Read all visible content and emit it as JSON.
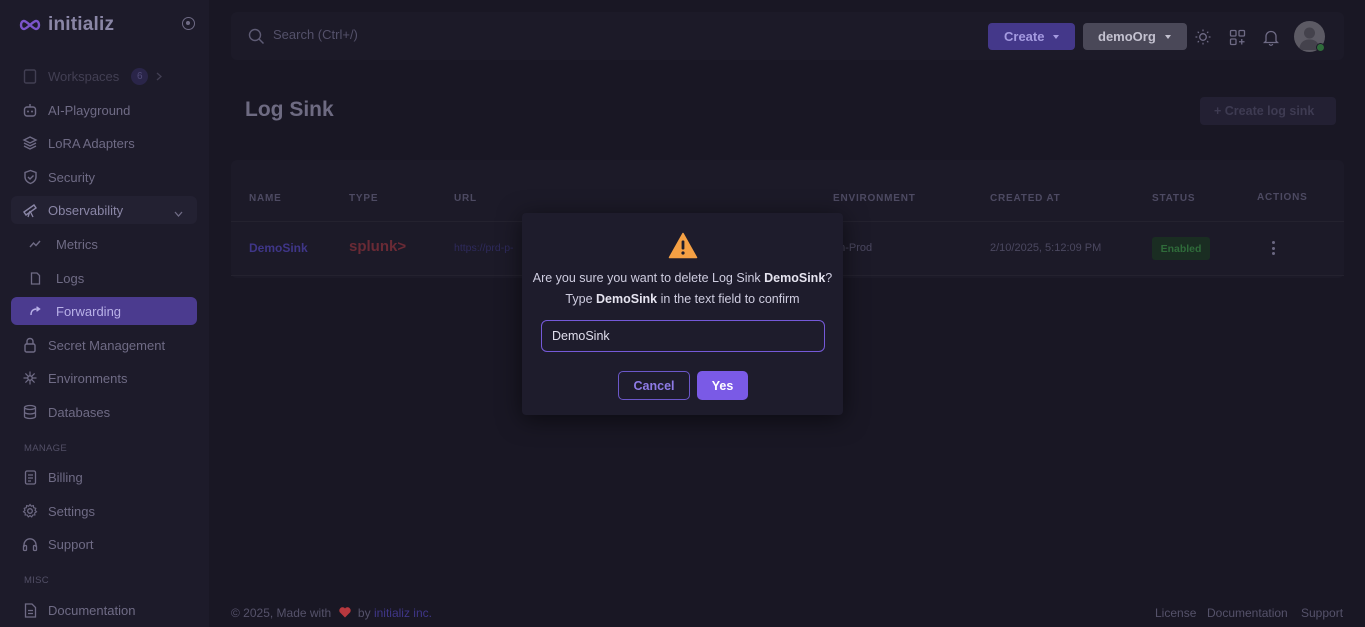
{
  "app": {
    "name": "initializ"
  },
  "sidebar": {
    "items": [
      {
        "label": "Workspaces",
        "badge": "6",
        "icon": "workspaces-icon"
      },
      {
        "label": "AI-Playground",
        "icon": "robot-icon"
      },
      {
        "label": "LoRA Adapters",
        "icon": "layers-icon"
      },
      {
        "label": "Security",
        "icon": "shield-icon"
      },
      {
        "label": "Observability",
        "icon": "telescope-icon"
      },
      {
        "label": "Metrics",
        "icon": "trend-icon"
      },
      {
        "label": "Logs",
        "icon": "file-icon"
      },
      {
        "label": "Forwarding",
        "icon": "forward-arrow-icon"
      },
      {
        "label": "Secret Management",
        "icon": "lock-icon"
      },
      {
        "label": "Environments",
        "icon": "nodes-icon"
      },
      {
        "label": "Databases",
        "icon": "database-icon"
      }
    ],
    "manage_label": "MANAGE",
    "manage_items": [
      {
        "label": "Billing",
        "icon": "receipt-icon"
      },
      {
        "label": "Settings",
        "icon": "gear-icon"
      },
      {
        "label": "Support",
        "icon": "headset-icon"
      }
    ],
    "misc_label": "MISC",
    "misc_items": [
      {
        "label": "Documentation",
        "icon": "document-icon"
      }
    ]
  },
  "topbar": {
    "search_placeholder": "Search (Ctrl+/)",
    "create_label": "Create",
    "org_label": "demoOrg"
  },
  "page": {
    "title": "Log Sink",
    "create_button": "+ Create log sink"
  },
  "table": {
    "headers": [
      "NAME",
      "TYPE",
      "URL",
      "ENVIRONMENT",
      "CREATED AT",
      "STATUS",
      "ACTIONS"
    ],
    "rows": [
      {
        "name": "DemoSink",
        "type": "splunk>",
        "url": "https://prd-p-",
        "environment": "on-Prod",
        "created_at": "2/10/2025, 5:12:09 PM",
        "status": "Enabled"
      }
    ]
  },
  "modal": {
    "q_prefix": "Are you sure you want to delete Log Sink ",
    "q_name": "DemoSink",
    "q_suffix": "?",
    "type_prefix": "Type ",
    "type_name": "DemoSink",
    "type_suffix": " in the text field to confirm",
    "input_value": "DemoSink",
    "cancel_label": "Cancel",
    "yes_label": "Yes"
  },
  "footer": {
    "copyright": "© 2025, Made with",
    "by": "by",
    "brand": "initializ inc.",
    "links": [
      "License",
      "Documentation",
      "Support"
    ]
  },
  "colors": {
    "accent": "#7a5ae6",
    "background": "#191724",
    "warning": "#f5a044",
    "status_enabled": "#2f6b3a"
  }
}
